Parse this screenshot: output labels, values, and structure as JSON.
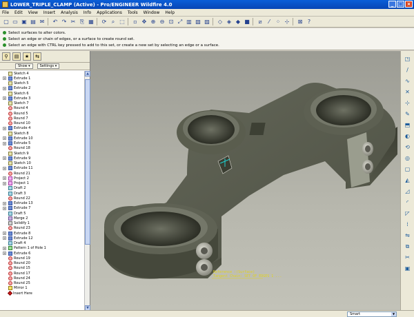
{
  "window": {
    "title": "LOWER_TRIPLE_CLAMP (Active) - Pro/ENGINEER Wildfire 4.0"
  },
  "menu": [
    "File",
    "Edit",
    "View",
    "Insert",
    "Analysis",
    "Info",
    "Applications",
    "Tools",
    "Window",
    "Help"
  ],
  "messages": [
    "Select surfaces to alter colors.",
    "Select an edge or chain of edges, or a surface to create round set.",
    "Select an edge with CTRL key pressed to add to this set, or create a new set by selecting an edge or a surface."
  ],
  "panel": {
    "show_label": "Show ▾",
    "settings_label": "Settings ▾"
  },
  "tree": [
    {
      "label": "Sketch 4",
      "type": "sketch",
      "exp": false
    },
    {
      "label": "Extrude 1",
      "type": "extrude",
      "exp": true
    },
    {
      "label": "Sketch 5",
      "type": "sketch",
      "exp": false
    },
    {
      "label": "Extrude 2",
      "type": "extrude",
      "exp": true
    },
    {
      "label": "Sketch 6",
      "type": "sketch",
      "exp": false
    },
    {
      "label": "Extrude 3",
      "type": "extrude",
      "exp": true
    },
    {
      "label": "Sketch 7",
      "type": "sketch",
      "exp": false
    },
    {
      "label": "Round 4",
      "type": "round",
      "exp": false
    },
    {
      "label": "Round 5",
      "type": "round",
      "exp": false
    },
    {
      "label": "Round 7",
      "type": "round",
      "exp": false
    },
    {
      "label": "Round 10",
      "type": "round",
      "exp": false
    },
    {
      "label": "Extrude 4",
      "type": "extrude",
      "exp": true
    },
    {
      "label": "Sketch 8",
      "type": "sketch",
      "exp": false
    },
    {
      "label": "Extrude 10",
      "type": "extrude",
      "exp": true
    },
    {
      "label": "Extrude 5",
      "type": "extrude",
      "exp": true
    },
    {
      "label": "Round 18",
      "type": "round",
      "exp": false
    },
    {
      "label": "Sketch 9",
      "type": "sketch",
      "exp": false
    },
    {
      "label": "Extrude 9",
      "type": "extrude",
      "exp": true
    },
    {
      "label": "Sketch 10",
      "type": "sketch",
      "exp": false
    },
    {
      "label": "Extrude 11",
      "type": "extrude",
      "exp": true
    },
    {
      "label": "Round 21",
      "type": "round",
      "exp": false
    },
    {
      "label": "Project 2",
      "type": "project",
      "exp": true
    },
    {
      "label": "Project 1",
      "type": "project",
      "exp": true
    },
    {
      "label": "Draft 2",
      "type": "draft",
      "exp": false
    },
    {
      "label": "Draft 3",
      "type": "draft",
      "exp": false
    },
    {
      "label": "Round 22",
      "type": "round",
      "exp": false
    },
    {
      "label": "Extrude 13",
      "type": "extrude",
      "exp": true
    },
    {
      "label": "Extrude 7",
      "type": "extrude",
      "exp": true
    },
    {
      "label": "Draft 5",
      "type": "draft",
      "exp": false
    },
    {
      "label": "Merge 2",
      "type": "merge",
      "exp": false
    },
    {
      "label": "Solidify 1",
      "type": "solidify",
      "exp": false
    },
    {
      "label": "Round 23",
      "type": "round",
      "exp": false
    },
    {
      "label": "Extrude 8",
      "type": "extrude",
      "exp": true
    },
    {
      "label": "Extrude 12",
      "type": "extrude",
      "exp": true
    },
    {
      "label": "Draft 4",
      "type": "draft",
      "exp": false
    },
    {
      "label": "Pattern 1 of Hole 1",
      "type": "pattern",
      "exp": true
    },
    {
      "label": "Extrude 6",
      "type": "extrude",
      "exp": true
    },
    {
      "label": "Round 19",
      "type": "round",
      "exp": false
    },
    {
      "label": "Round 20",
      "type": "round",
      "exp": false
    },
    {
      "label": "Round 15",
      "type": "round",
      "exp": false
    },
    {
      "label": "Round 17",
      "type": "round",
      "exp": false
    },
    {
      "label": "Round 24",
      "type": "round",
      "exp": false
    },
    {
      "label": "Round 25",
      "type": "round",
      "exp": false
    },
    {
      "label": "Mirror 1",
      "type": "mirror",
      "exp": false
    },
    {
      "label": "Insert Here",
      "type": "insert",
      "exp": false
    }
  ],
  "viewport": {
    "annotation_line1": "Reference  :(Surface)",
    "annotation_line2": "Tangent Chain: SET OF EDGES 1 ..."
  },
  "status": {
    "filter_value": "Smart"
  },
  "colors": {
    "model": "#4a4d3f",
    "background": "#b0b0a6",
    "selection": "#e2d31a"
  }
}
